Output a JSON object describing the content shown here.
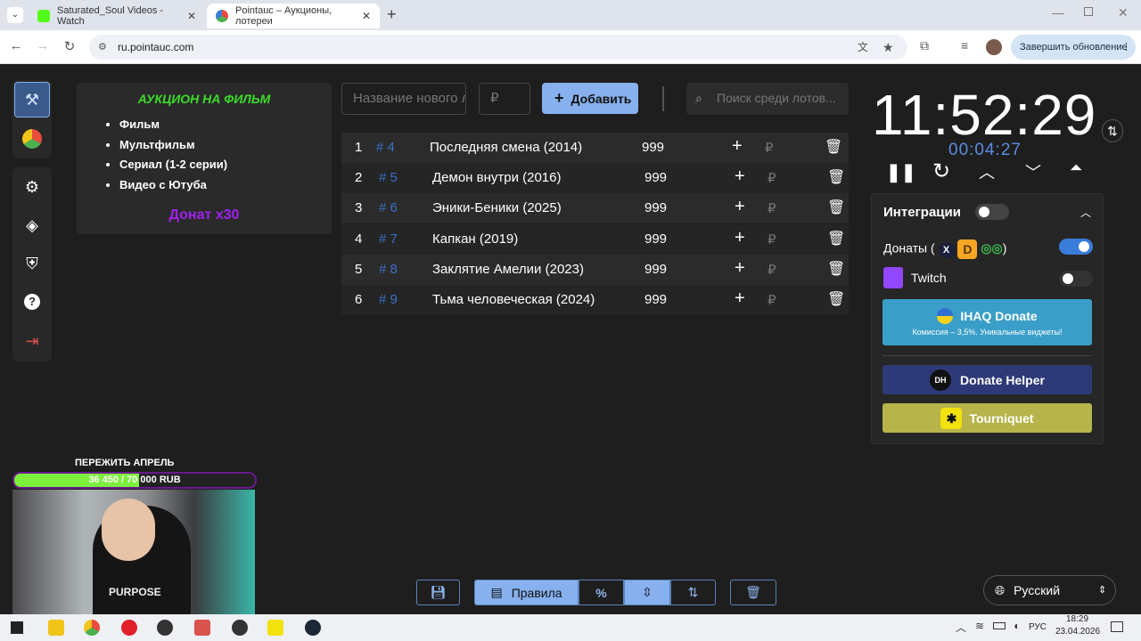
{
  "browser": {
    "tabs": [
      {
        "label": "Saturated_Soul Videos - Watch",
        "active": false
      },
      {
        "label": "Pointauc – Аукционы, лотереи",
        "active": true
      }
    ],
    "new_tab": "+",
    "url": "ru.pointauc.com",
    "update_button": "Завершить обновление"
  },
  "info_card": {
    "title": "АУКЦИОН НА ФИЛЬМ",
    "items": [
      "Фильм",
      "Мультфильм",
      "Сериал (1-2 серии)",
      "Видео с Ютуба"
    ],
    "donate_multiplier": "Донат x30"
  },
  "toolbar": {
    "name_placeholder": "Название нового лота",
    "amount_placeholder": "₽",
    "add_label": "Добавить",
    "search_placeholder": "Поиск среди лотов..."
  },
  "lots": [
    {
      "index": "1",
      "id": "# 4",
      "name": "Последняя смена (2014)",
      "amount": "999"
    },
    {
      "index": "2",
      "id": "# 5",
      "name": "Демон внутри (2016)",
      "amount": "999"
    },
    {
      "index": "3",
      "id": "# 6",
      "name": "Эники-Беники (2025)",
      "amount": "999"
    },
    {
      "index": "4",
      "id": "# 7",
      "name": "Капкан (2019)",
      "amount": "999"
    },
    {
      "index": "5",
      "id": "# 8",
      "name": "Заклятие Амелии (2023)",
      "amount": "999"
    },
    {
      "index": "6",
      "id": "# 9",
      "name": "Тьма человеческая (2024)",
      "amount": "999"
    }
  ],
  "lot_currency": "₽",
  "timer": {
    "clock": "11:52:29",
    "countdown": "00:04:27"
  },
  "integrations": {
    "title": "Интеграции",
    "donations_label": "Донаты (",
    "donations_close": ")",
    "twitch_label": "Twitch",
    "ihaq": {
      "label": "IHAQ Donate",
      "sub": "Комиссия – 3,5%. Уникальные виджеты!"
    },
    "donate_helper": "Donate Helper",
    "donate_helper_badge": "DH",
    "tourniquet": "Tourniquet"
  },
  "bottom_bar": {
    "rules": "Правила",
    "percent": "%"
  },
  "language": "Русский",
  "overlay": {
    "goal_title": "ПЕРЕЖИТЬ АПРЕЛЬ",
    "goal_text": "36 450 / 70 000 RUB",
    "goal_progress": 0.52,
    "webcam_text": "PURPOSE"
  },
  "taskbar": {
    "lang": "РУС",
    "time": "18:29",
    "date": "23.04.2026"
  },
  "colors": {
    "accent": "#86b0ee",
    "title_green": "#3cdc2a",
    "donate_purple": "#a020f0",
    "toggle_on": "#3a7cd9",
    "ihaq": "#3a9fc8",
    "donate_helper": "#2e3a78",
    "tourniquet": "#b6b44a"
  }
}
